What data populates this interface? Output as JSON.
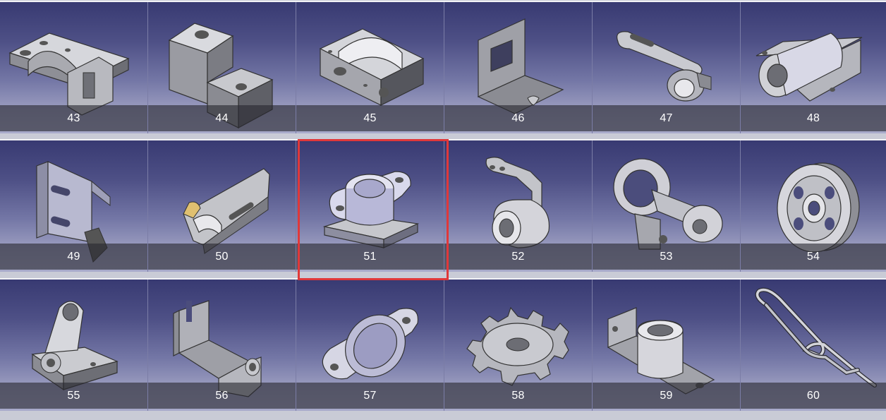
{
  "gallery": {
    "rows": [
      {
        "items": [
          {
            "label": "43",
            "icon": "clamp-bracket-part-icon"
          },
          {
            "label": "44",
            "icon": "block-with-hole-part-icon"
          },
          {
            "label": "45",
            "icon": "saddle-block-part-icon"
          },
          {
            "label": "46",
            "icon": "sheet-metal-bracket-part-icon"
          },
          {
            "label": "47",
            "icon": "slotted-arm-part-icon"
          },
          {
            "label": "48",
            "icon": "pillow-block-part-icon"
          }
        ]
      },
      {
        "items": [
          {
            "label": "49",
            "icon": "slotted-plate-part-icon"
          },
          {
            "label": "50",
            "icon": "channel-block-part-icon"
          },
          {
            "label": "51",
            "icon": "flange-bearing-part-icon"
          },
          {
            "label": "52",
            "icon": "hinge-bushing-part-icon"
          },
          {
            "label": "53",
            "icon": "rocker-arm-part-icon"
          },
          {
            "label": "54",
            "icon": "pulley-wheel-part-icon"
          }
        ]
      },
      {
        "items": [
          {
            "label": "55",
            "icon": "pivot-bracket-part-icon"
          },
          {
            "label": "56",
            "icon": "u-bracket-part-icon"
          },
          {
            "label": "57",
            "icon": "flange-ring-part-icon"
          },
          {
            "label": "58",
            "icon": "sprocket-part-icon"
          },
          {
            "label": "59",
            "icon": "arm-with-boss-part-icon"
          },
          {
            "label": "60",
            "icon": "wire-clip-part-icon"
          }
        ]
      }
    ],
    "selected": "51",
    "selection_color": "#e0383a",
    "caption_color": "#ffffff"
  }
}
